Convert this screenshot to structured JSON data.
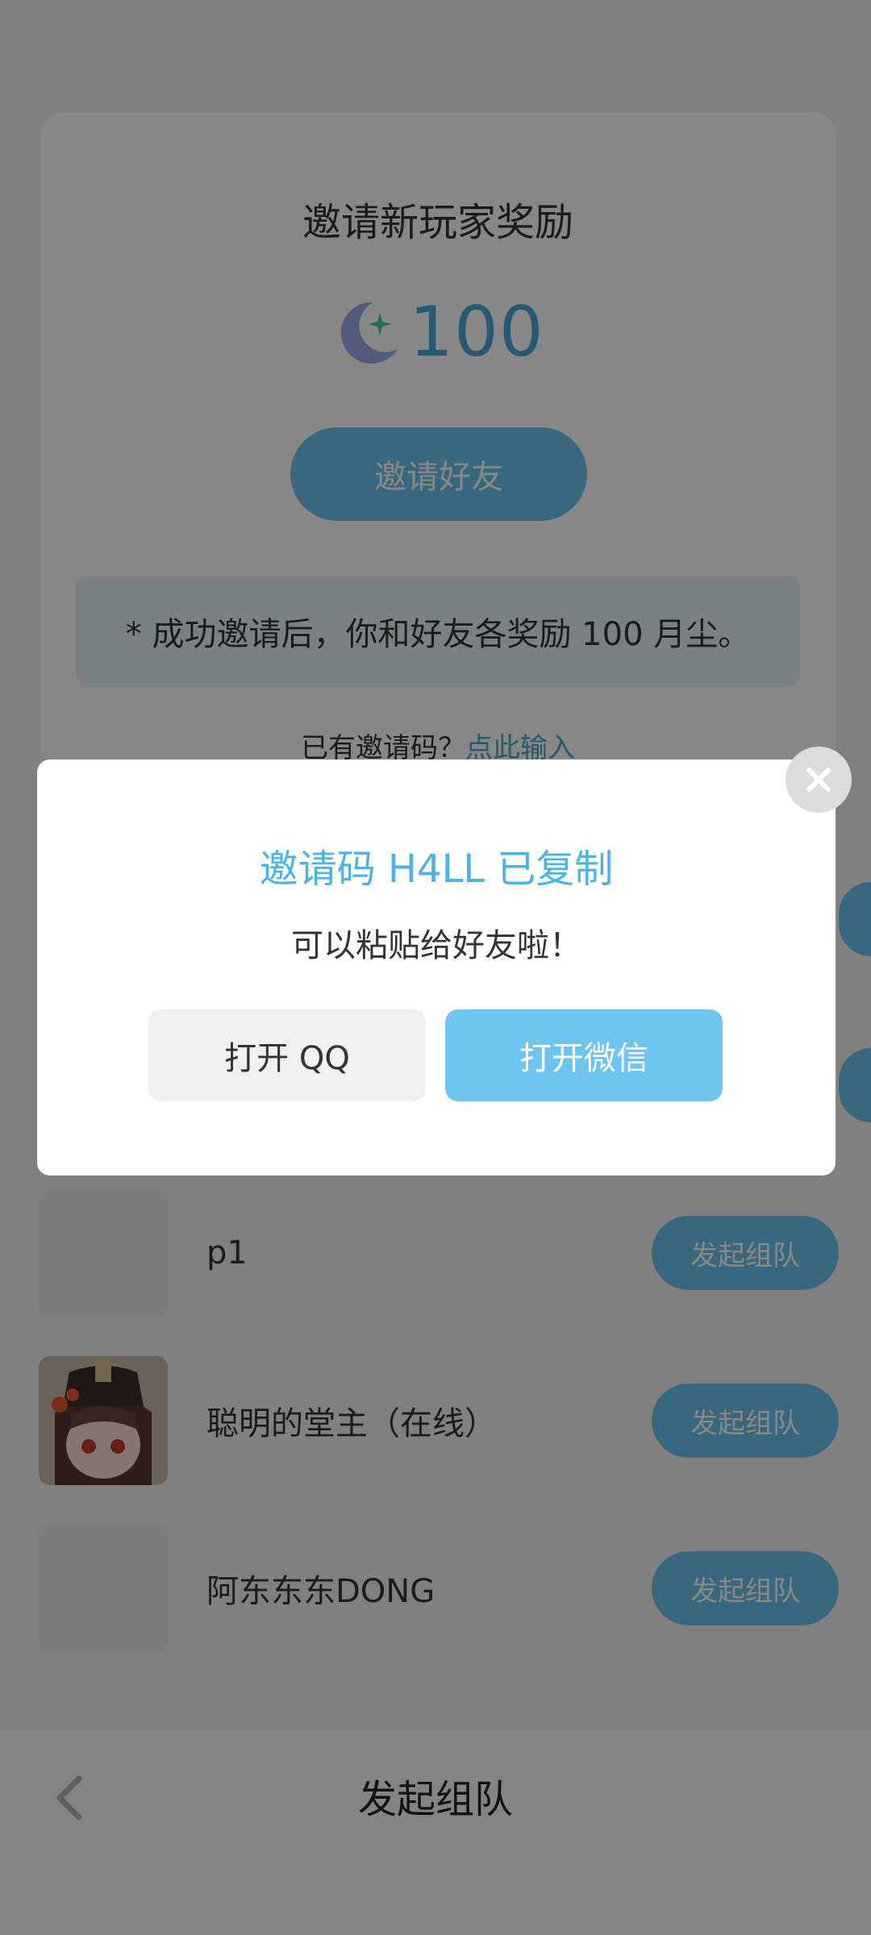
{
  "invite_card": {
    "title": "邀请新玩家奖励",
    "reward_icon": "moon-star-icon",
    "reward_amount": "100",
    "invite_button_label": "邀请好友",
    "notice": "* 成功邀请后，你和好友各奖励 100 月尘。",
    "has_code_text": "已有邀请码？",
    "enter_code_link": "点此输入"
  },
  "friends": [
    {
      "name": "p1",
      "button": "发起组队",
      "avatar": "blank"
    },
    {
      "name": "聪明的堂主（在线）",
      "button": "发起组队",
      "avatar": "anime-character"
    },
    {
      "name": "阿东东东DONG",
      "button": "发起组队",
      "avatar": "blank"
    }
  ],
  "bottom_bar": {
    "title": "发起组队",
    "back_icon": "chevron-left-icon"
  },
  "modal": {
    "title": "邀请码 H4LL 已复制",
    "subtitle": "可以粘贴给好友啦！",
    "qq_button": "打开 QQ",
    "wechat_button": "打开微信",
    "close_icon": "close-icon"
  },
  "colors": {
    "accent": "#6cc4ef",
    "accent_text": "#4ab4e6",
    "overlay": "rgba(0,0,0,0.47)"
  }
}
